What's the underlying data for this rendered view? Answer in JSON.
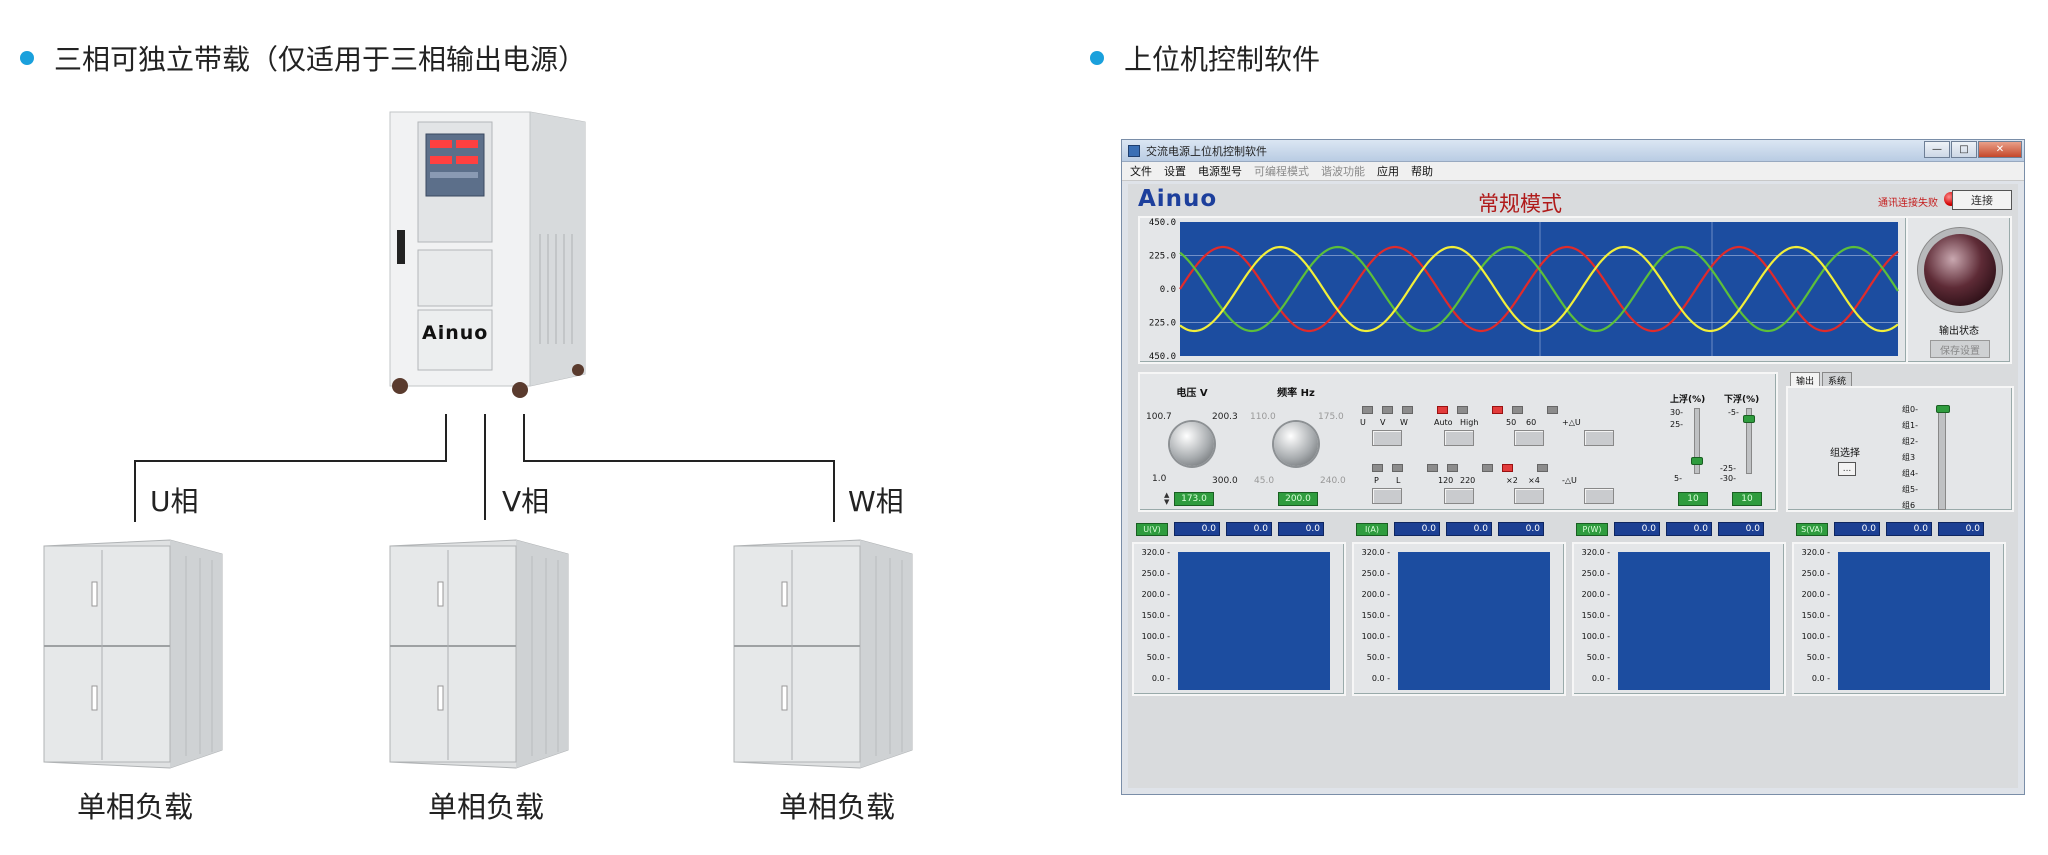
{
  "left_section": {
    "title": "三相可独立带载（仅适用于三相输出电源）",
    "source_brand": "Ainuo",
    "phases": [
      {
        "label": "U相",
        "load_label": "单相负载"
      },
      {
        "label": "V相",
        "load_label": "单相负载"
      },
      {
        "label": "W相",
        "load_label": "单相负载"
      }
    ]
  },
  "right_section": {
    "title": "上位机控制软件"
  },
  "window": {
    "title": "交流电源上位机控制软件",
    "controls": [
      "—",
      "□",
      "✕"
    ],
    "menu": [
      {
        "label": "文件",
        "enabled": true
      },
      {
        "label": "设置",
        "enabled": true
      },
      {
        "label": "电源型号",
        "enabled": true
      },
      {
        "label": "可编程模式",
        "enabled": false
      },
      {
        "label": "谐波功能",
        "enabled": false
      },
      {
        "label": "应用",
        "enabled": true
      },
      {
        "label": "帮助",
        "enabled": true
      }
    ],
    "brand": "Ainuo",
    "mode_title": "常规模式",
    "comm_status": "通讯连接失败",
    "connect_button": "连接",
    "waveform": {
      "y_ticks": [
        "450.0",
        "225.0",
        "0.0",
        "225.0",
        "450.0"
      ],
      "series_colors": [
        "#e02b2b",
        "#5cbf3a",
        "#f2ef3a"
      ]
    },
    "output": {
      "label": "输出状态",
      "button": "保存设置"
    },
    "voltage": {
      "title": "电压 V",
      "min": "1.0",
      "max": "300.0",
      "mark_left": "100.7",
      "mark_right": "200.3",
      "value": "173.0"
    },
    "frequency": {
      "title": "频率 Hz",
      "min": "45.0",
      "max": "240.0",
      "mark_left": "110.0",
      "mark_right": "175.0",
      "value": "200.0"
    },
    "switches": {
      "row1_labels": [
        "U",
        "V",
        "W",
        "Auto",
        "High",
        "50",
        "60",
        "+△U"
      ],
      "row2_labels": [
        "P",
        "L",
        "120",
        "220",
        "×2",
        "×4",
        "-△U"
      ]
    },
    "float_up": {
      "title": "上浮(%)",
      "ticks": [
        "30-",
        "25-",
        "5-"
      ],
      "value": "10"
    },
    "float_down": {
      "title": "下浮(%)",
      "ticks": [
        "-5-",
        "-25-",
        "-30-"
      ],
      "value": "10"
    },
    "tabs": [
      "输出",
      "系统"
    ],
    "group_selector": {
      "label": "组选择",
      "button": "...",
      "ticks": [
        "组0-",
        "组1-",
        "组2-",
        "组3",
        "组4-",
        "组5-",
        "组6"
      ]
    },
    "meters": [
      {
        "label": "U(V)",
        "values": [
          "0.0",
          "0.0",
          "0.0"
        ]
      },
      {
        "label": "I(A)",
        "values": [
          "0.0",
          "0.0",
          "0.0"
        ]
      },
      {
        "label": "P(W)",
        "values": [
          "0.0",
          "0.0",
          "0.0"
        ]
      },
      {
        "label": "S(VA)",
        "values": [
          "0.0",
          "0.0",
          "0.0"
        ]
      }
    ],
    "mini_chart_ticks": [
      "320.0",
      "250.0",
      "200.0",
      "150.0",
      "100.0",
      "50.0",
      "0.0"
    ]
  }
}
